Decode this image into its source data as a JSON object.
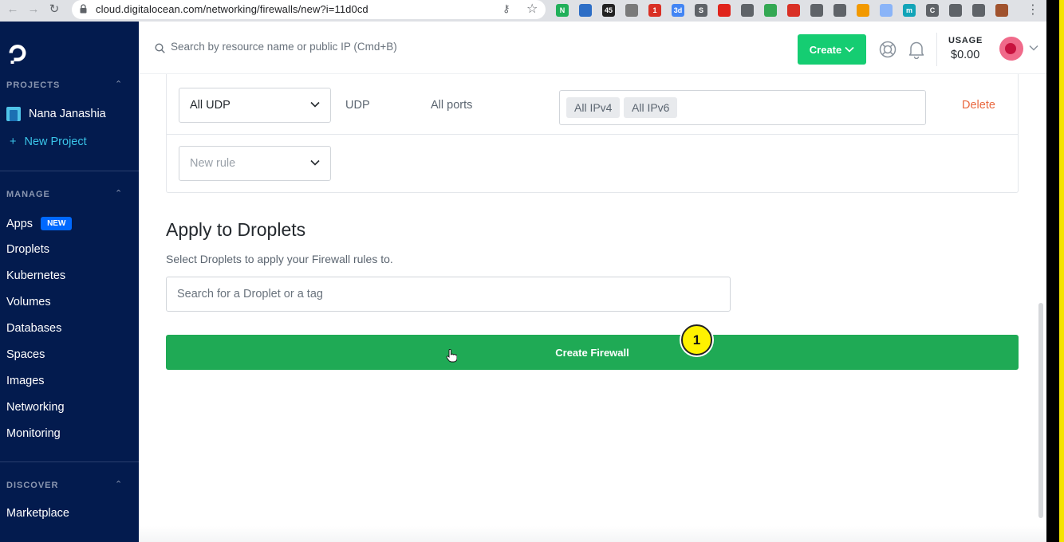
{
  "browser": {
    "url": "cloud.digitalocean.com/networking/firewalls/new?i=11d0cd",
    "extensions": [
      {
        "name": "N",
        "color": "#21b05a"
      },
      {
        "name": "",
        "color": "#2d6ec6"
      },
      {
        "name": "45",
        "color": "#222222"
      },
      {
        "name": "",
        "color": "#7a7a7a"
      },
      {
        "name": "1",
        "color": "#d93025"
      },
      {
        "name": "3d",
        "color": "#4285f4"
      },
      {
        "name": "S",
        "color": "#5f6368"
      },
      {
        "name": "",
        "color": "#e0241c"
      },
      {
        "name": "",
        "color": "#5f6368"
      },
      {
        "name": "",
        "color": "#34a853"
      },
      {
        "name": "",
        "color": "#d93025"
      },
      {
        "name": "",
        "color": "#5f6368"
      },
      {
        "name": "",
        "color": "#5f6368"
      },
      {
        "name": "",
        "color": "#f29900"
      },
      {
        "name": "",
        "color": "#8ab4f8"
      },
      {
        "name": "m",
        "color": "#12a4b8"
      },
      {
        "name": "C",
        "color": "#5f6368"
      },
      {
        "name": "",
        "color": "#5f6368"
      },
      {
        "name": "",
        "color": "#5f6368"
      },
      {
        "name": "",
        "color": "#a0522d"
      }
    ]
  },
  "sidebar": {
    "projects_heading": "PROJECTS",
    "project_name": "Nana Janashia",
    "new_project": "New Project",
    "manage_heading": "MANAGE",
    "items": [
      "Apps",
      "Droplets",
      "Kubernetes",
      "Volumes",
      "Databases",
      "Spaces",
      "Images",
      "Networking",
      "Monitoring"
    ],
    "apps_badge": "NEW",
    "discover_heading": "DISCOVER",
    "marketplace": "Marketplace"
  },
  "header": {
    "search_placeholder": "Search by resource name or public IP (Cmd+B)",
    "create_label": "Create",
    "usage_label": "USAGE",
    "usage_value": "$0.00"
  },
  "rules": {
    "row1": {
      "type": "All UDP",
      "protocol": "UDP",
      "ports": "All ports",
      "sources": [
        "All IPv4",
        "All IPv6"
      ],
      "delete_label": "Delete"
    },
    "new_rule_placeholder": "New rule"
  },
  "apply": {
    "heading": "Apply to Droplets",
    "subheading": "Select Droplets to apply your Firewall rules to.",
    "search_placeholder": "Search for a Droplet or a tag",
    "submit_label": "Create Firewall"
  },
  "overlay": {
    "step_marker": "1"
  },
  "colors": {
    "sidebar_bg": "#031b4e",
    "primary_green": "#15cd72",
    "submit_green": "#1faa55",
    "delete_orange": "#e9683f",
    "new_project_blue": "#3ac4e8"
  }
}
